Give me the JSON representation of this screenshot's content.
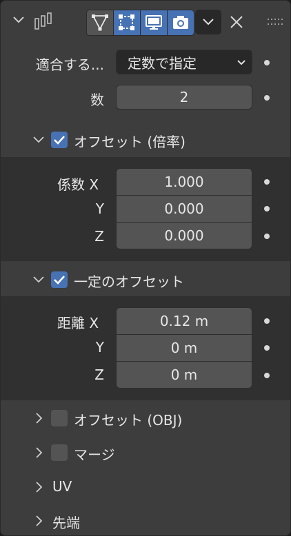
{
  "header": {
    "toggles": [
      {
        "name": "edit-mode",
        "icon": "vertex-triangle-icon",
        "active": false
      },
      {
        "name": "on-cage",
        "icon": "editmode-square-icon",
        "active": true
      },
      {
        "name": "viewport",
        "icon": "monitor-icon",
        "active": true
      },
      {
        "name": "render",
        "icon": "camera-icon",
        "active": true
      }
    ]
  },
  "fit": {
    "label": "適合する...",
    "value": "定数で指定"
  },
  "count": {
    "label": "数",
    "value": "2"
  },
  "relative_offset": {
    "title": "オフセット (倍率)",
    "enabled": true,
    "factor_label": "係数",
    "rows": [
      {
        "axis": "X",
        "value": "1.000"
      },
      {
        "axis": "Y",
        "value": "0.000"
      },
      {
        "axis": "Z",
        "value": "0.000"
      }
    ]
  },
  "constant_offset": {
    "title": "一定のオフセット",
    "enabled": true,
    "distance_label": "距離",
    "rows": [
      {
        "axis": "X",
        "value": "0.12 m"
      },
      {
        "axis": "Y",
        "value": "0 m"
      },
      {
        "axis": "Z",
        "value": "0 m"
      }
    ]
  },
  "collapsed": {
    "object_offset": "オフセット (OBJ)",
    "merge": "マージ",
    "uv": "UV",
    "caps": "先端"
  },
  "colors": {
    "accent": "#4772b3",
    "panel": "#3d3d3d",
    "subpanel": "#303030",
    "field": "#545454"
  }
}
